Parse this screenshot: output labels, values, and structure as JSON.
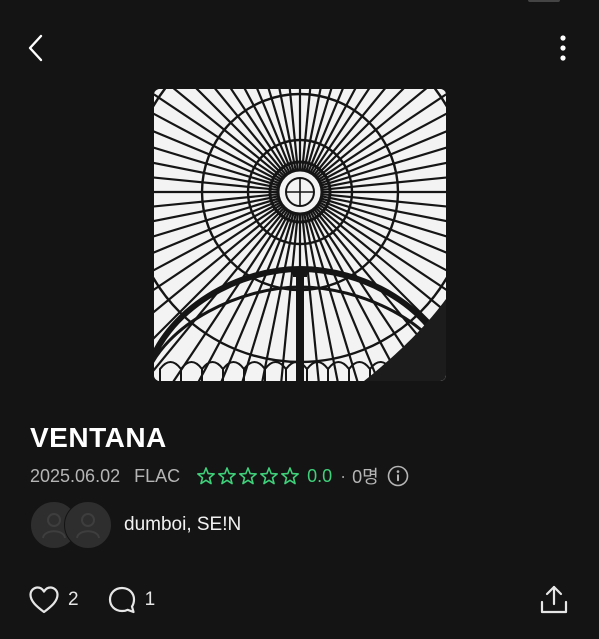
{
  "header": {
    "back_icon": "chevron-left-icon",
    "more_icon": "more-vertical-icon"
  },
  "cover": {
    "description_icon": "album-cover-dome"
  },
  "album": {
    "title": "VENTANA",
    "date": "2025.06.02",
    "format": "FLAC",
    "rating": "0.0",
    "star_count": 5,
    "separator": "·",
    "rater_count": "0명",
    "rating_color": "#3fd07a"
  },
  "artists": {
    "names": "dumboi, SE!N"
  },
  "actions": {
    "likes": "2",
    "comments": "1"
  },
  "colors": {
    "background": "#141414",
    "accent": "#3fd07a"
  }
}
